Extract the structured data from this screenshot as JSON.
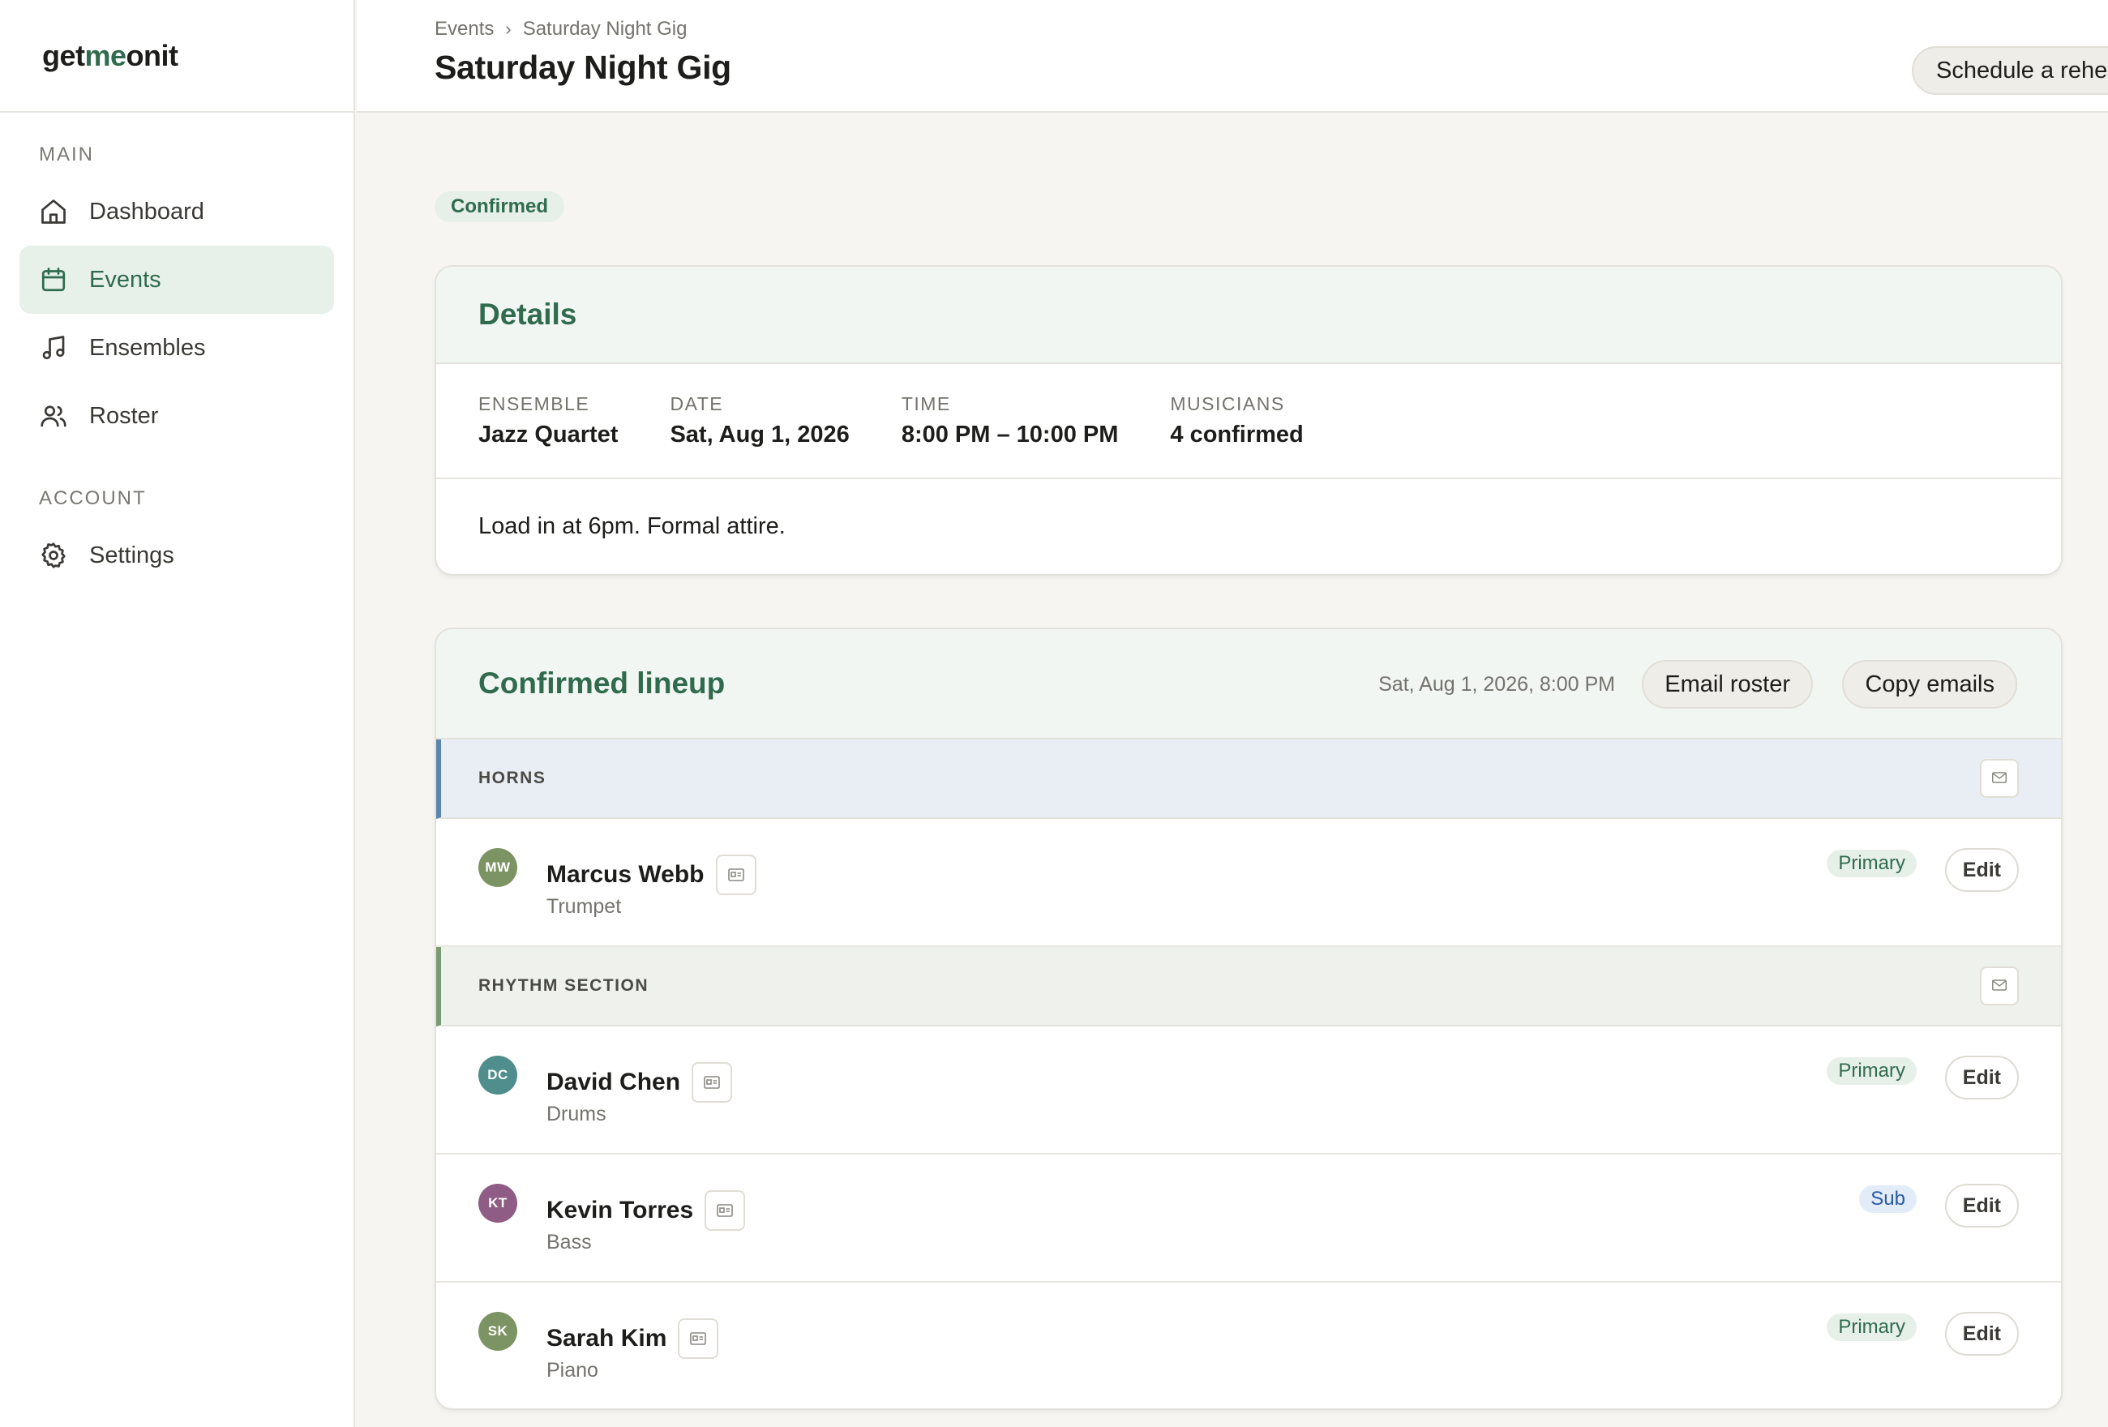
{
  "app": {
    "brand_prefix": "get",
    "brand_accent": "me",
    "brand_suffix": "onit"
  },
  "sidebar": {
    "sections": [
      {
        "label": "MAIN",
        "items": [
          {
            "label": "Dashboard",
            "icon": "home-icon",
            "active": false
          },
          {
            "label": "Events",
            "icon": "calendar-icon",
            "active": true
          },
          {
            "label": "Ensembles",
            "icon": "music-note-icon",
            "active": false
          },
          {
            "label": "Roster",
            "icon": "users-icon",
            "active": false
          }
        ]
      },
      {
        "label": "ACCOUNT",
        "items": [
          {
            "label": "Settings",
            "icon": "gear-icon",
            "active": false
          }
        ]
      }
    ]
  },
  "header": {
    "breadcrumb": [
      "Events",
      "Saturday Night Gig"
    ],
    "breadcrumb_separator": "›",
    "title": "Saturday Night Gig",
    "action_label": "Schedule a rehe"
  },
  "event": {
    "status": "Confirmed",
    "details": {
      "title": "Details",
      "fields": [
        {
          "key": "ENSEMBLE",
          "value": "Jazz Quartet"
        },
        {
          "key": "DATE",
          "value": "Sat, Aug 1, 2026"
        },
        {
          "key": "TIME",
          "value": "8:00 PM – 10:00 PM"
        },
        {
          "key": "MUSICIANS",
          "value": "4 confirmed"
        }
      ],
      "notes": "Load in at 6pm. Formal attire."
    },
    "lineup": {
      "title": "Confirmed lineup",
      "timestamp": "Sat, Aug 1, 2026, 8:00 PM",
      "email_label": "Email roster",
      "copy_label": "Copy emails",
      "edit_label": "Edit",
      "sections": [
        {
          "name": "HORNS",
          "accent": "#5a86ad",
          "members": [
            {
              "initials": "MW",
              "name": "Marcus Webb",
              "instrument": "Trumpet",
              "role": "Primary",
              "avatar_color": "#7c9463"
            }
          ]
        },
        {
          "name": "RHYTHM SECTION",
          "accent": "#7a9a74",
          "members": [
            {
              "initials": "DC",
              "name": "David Chen",
              "instrument": "Drums",
              "role": "Primary",
              "avatar_color": "#4f8e8c"
            },
            {
              "initials": "KT",
              "name": "Kevin Torres",
              "instrument": "Bass",
              "role": "Sub",
              "avatar_color": "#8e5c85"
            },
            {
              "initials": "SK",
              "name": "Sarah Kim",
              "instrument": "Piano",
              "role": "Primary",
              "avatar_color": "#7c9463"
            }
          ]
        }
      ]
    }
  },
  "colors": {
    "brand_green": "#2f6b4c",
    "sub_blue": "#2a5aa8",
    "page_bg": "#f6f5f2"
  }
}
